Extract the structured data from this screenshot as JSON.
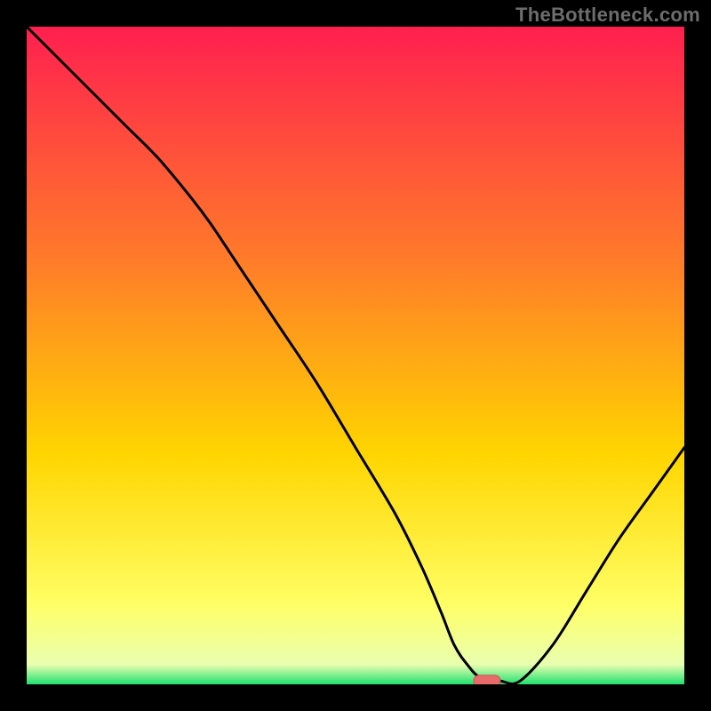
{
  "watermark": "TheBottleneck.com",
  "colors": {
    "bg": "#000000",
    "grad_top": "#ff1f4f",
    "grad_mid1": "#ff7a2a",
    "grad_mid2": "#ffd500",
    "grad_low": "#ffff66",
    "grad_green": "#20e070",
    "curve": "#000000",
    "marker_fill": "#e96a6a",
    "marker_stroke": "#d05050"
  },
  "chart_data": {
    "type": "line",
    "title": "",
    "xlabel": "",
    "ylabel": "",
    "xlim": [
      0,
      100
    ],
    "ylim": [
      0,
      100
    ],
    "x": [
      0,
      5,
      10,
      15,
      20,
      25,
      28,
      32,
      38,
      44,
      50,
      56,
      60,
      63,
      65,
      67,
      69,
      72,
      75,
      80,
      85,
      90,
      95,
      100
    ],
    "values": [
      100,
      95,
      90,
      85,
      80,
      74,
      70,
      64,
      55,
      46,
      36,
      26,
      18,
      11,
      6,
      3,
      1,
      0.5,
      0.5,
      6,
      14,
      22,
      29,
      36
    ],
    "marker": {
      "x": 70,
      "y": 0.5
    },
    "annotations": []
  }
}
